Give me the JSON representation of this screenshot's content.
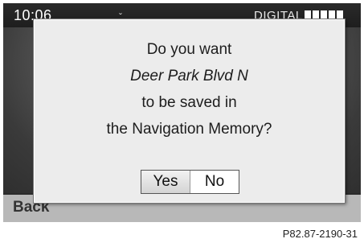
{
  "status_bar": {
    "time": "10:06",
    "center_mark": "ˇ",
    "digital_label": "DIGITAL",
    "signal_level": "5/5"
  },
  "dialog": {
    "line1": "Do you want",
    "line2": "Deer Park Blvd N",
    "line3": "to be saved in",
    "line4": "the Navigation Memory?",
    "yes_label": "Yes",
    "no_label": "No"
  },
  "bottom_bar": {
    "back_label": "Back"
  },
  "caption": "P82.87-2190-31",
  "colors": {
    "screen_bg": "#2b2b2b",
    "dialog_bg": "#ececec",
    "bottom_bar_bg": "#b8b8b8",
    "text": "#1d1d1d"
  }
}
